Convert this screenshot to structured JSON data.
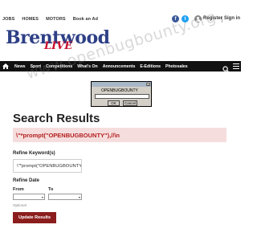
{
  "toplinks": [
    "JOBS",
    "HOMES",
    "MOTORS",
    "Book an Ad"
  ],
  "social": {
    "facebook": "f",
    "twitter": "t"
  },
  "account": {
    "register": "Register",
    "signin": "Sign in"
  },
  "logo": {
    "main": "Brentwood",
    "sub": "LIVE"
  },
  "watermark": "www.openbugbounty.org",
  "nav": [
    "News",
    "Sport",
    "Competitions",
    "What's On",
    "Announcements",
    "E-Editions",
    "Photosales"
  ],
  "dialog": {
    "message": "OPENBUGBOUNTY",
    "input_value": "",
    "ok_label": "OK",
    "cancel_label": "Cancel",
    "close_glyph": "×"
  },
  "main": {
    "title": "Search Results",
    "query_echo": "\\\"*prompt(\"OPENBUGBOUNTY\"),//\\n",
    "keyword_label": "Refine Keyword(s)",
    "keyword_value": "\\\"*prompt(\"OPENBUGBOUNTY\"),//\\n",
    "date_label": "Refine Date",
    "from_label": "From",
    "to_label": "To",
    "from_value": "",
    "to_value": "",
    "optional_note": "Optional",
    "update_button": "Update Results"
  },
  "colors": {
    "nav_bg": "#111111",
    "logo_blue": "#2d3f86",
    "logo_red": "#c8102e",
    "query_bg": "#f6dddd",
    "query_text": "#b21e1e",
    "button_bg": "#8c1d1d"
  },
  "icons": [
    "facebook-icon",
    "twitter-icon",
    "user-icon",
    "home-icon",
    "search-icon",
    "menu-icon",
    "close-icon",
    "chevron-down-icon"
  ]
}
